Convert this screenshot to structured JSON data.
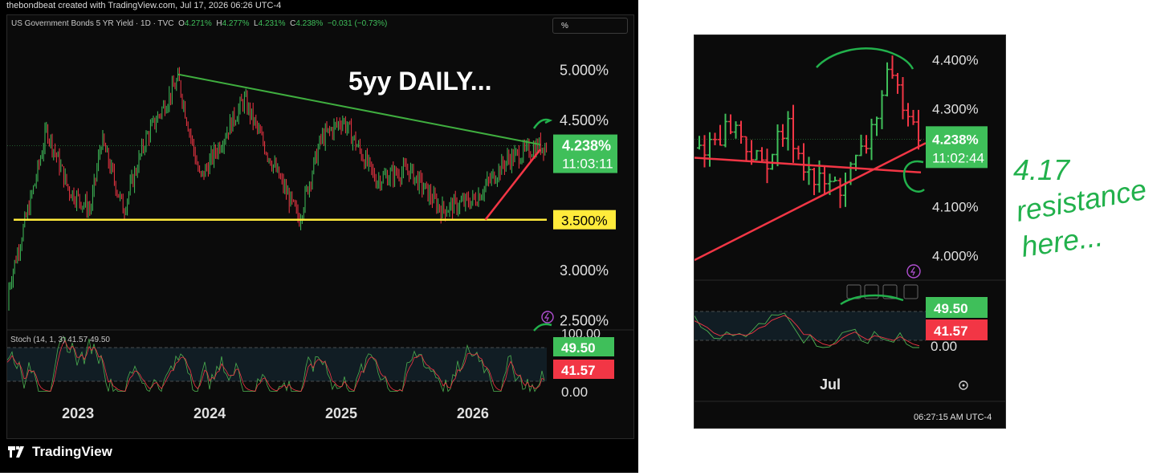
{
  "header": {
    "credit": "thebondbeat created with TradingView.com, Jul 17, 2026 06:26 UTC-4",
    "symbol": "US Government Bonds 5 YR Yield · 1D · TVC",
    "o_label": "O",
    "o": "4.271%",
    "h_label": "H",
    "h": "4.277%",
    "l_label": "L",
    "l": "4.231%",
    "c_label": "C",
    "c": "4.238%",
    "chg": "−0.031 (−0.73%)"
  },
  "scale_button": "%",
  "brand": "TradingView",
  "colors": {
    "up": "#3fbf5a",
    "down": "#f23645",
    "trendline": "#3fae3f",
    "support": "#ffeb3b",
    "annotation": "#22b14c",
    "background": "#0b0b0b"
  },
  "chart_data": [
    {
      "type": "ohlc",
      "title": "5yy DAILY...",
      "x_ticks": [
        "2023",
        "2024",
        "2025",
        "2026"
      ],
      "y_ticks": [
        "5.000%",
        "4.500%",
        "3.000%",
        "2.500%"
      ],
      "ylim": [
        2.4,
        5.3
      ],
      "series_close": {
        "dates": [
          "2022-06",
          "2022-09",
          "2022-10",
          "2022-12",
          "2023-02",
          "2023-03",
          "2023-05",
          "2023-07",
          "2023-10",
          "2023-12",
          "2024-02",
          "2024-04",
          "2024-06",
          "2024-09",
          "2024-11",
          "2025-01",
          "2025-04",
          "2025-07",
          "2025-10",
          "2026-01",
          "2026-04",
          "2026-07"
        ],
        "values": [
          2.6,
          3.9,
          4.4,
          3.8,
          3.6,
          4.3,
          3.6,
          4.3,
          4.9,
          3.9,
          4.3,
          4.7,
          4.2,
          3.5,
          4.3,
          4.5,
          3.9,
          4.0,
          3.6,
          3.7,
          4.1,
          4.238
        ]
      },
      "price_labels": [
        {
          "label": "4.238%",
          "sub": "11:03:11",
          "color": "#3fbf5a"
        },
        {
          "label": "3.500%",
          "color": "#ffeb3b"
        }
      ],
      "lines": [
        {
          "name": "Downtrend resistance",
          "from": [
            "2023-10",
            4.95
          ],
          "to": [
            "2026-07",
            4.25
          ]
        },
        {
          "name": "3.5% support",
          "value": 3.5
        },
        {
          "name": "Uptrend",
          "from": [
            "2026-02",
            3.5
          ],
          "to": [
            "2026-07",
            4.2
          ]
        }
      ],
      "stoch": {
        "label": "Stoch (14, 1, 3)",
        "k": "41.57",
        "d": "49.50",
        "y_ticks": [
          "100.00",
          "0.00"
        ]
      }
    },
    {
      "type": "ohlc",
      "x_ticks": [
        "Jul"
      ],
      "y_ticks": [
        "4.400%",
        "4.300%",
        "4.100%",
        "4.000%"
      ],
      "ylim": [
        3.95,
        4.45
      ],
      "series_close": {
        "dates": [
          "2026-05-20",
          "2026-05-28",
          "2026-06-05",
          "2026-06-12",
          "2026-06-19",
          "2026-06-26",
          "2026-07-02",
          "2026-07-08",
          "2026-07-14",
          "2026-07-17"
        ],
        "values": [
          4.22,
          4.27,
          4.18,
          4.26,
          4.15,
          4.14,
          4.22,
          4.36,
          4.3,
          4.238
        ]
      },
      "price_labels": [
        {
          "label": "4.238%",
          "sub": "11:02:44",
          "color": "#3fbf5a"
        }
      ],
      "stoch": {
        "k": "41.57",
        "d": "49.50",
        "y_ticks": [
          "0.00"
        ]
      },
      "time_label": "06:27:15 AM UTC-4"
    }
  ],
  "handwriting": "4.17 resistance here..."
}
